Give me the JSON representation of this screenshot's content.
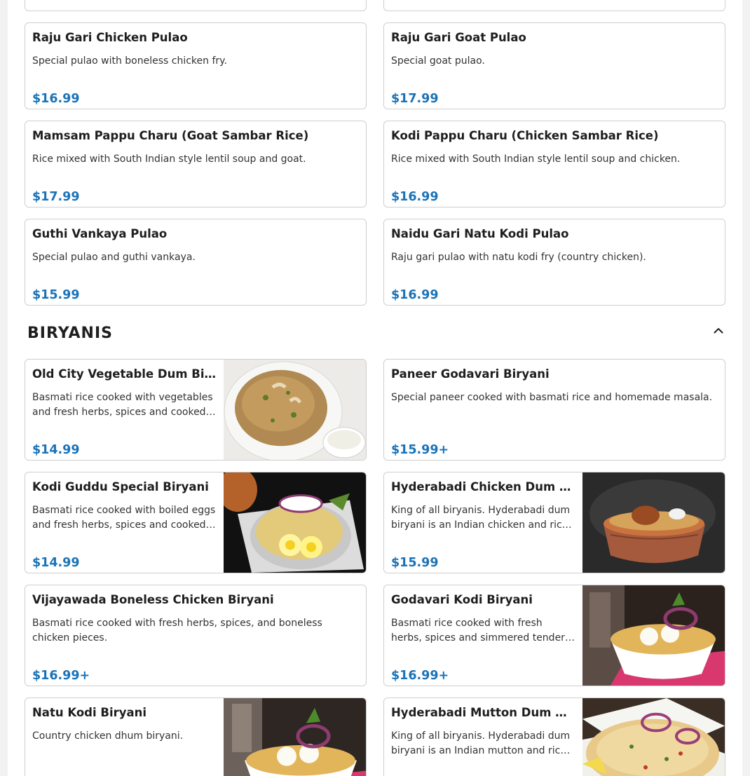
{
  "pulao_items": [
    {
      "name": "Raju Gari Chicken Pulao",
      "description": "Special pulao with boneless chicken fry.",
      "price": "$16.99"
    },
    {
      "name": "Raju Gari Goat Pulao",
      "description": "Special goat pulao.",
      "price": "$17.99"
    },
    {
      "name": "Mamsam Pappu Charu (Goat Sambar Rice)",
      "description": "Rice mixed with South Indian style lentil soup and goat.",
      "price": "$17.99"
    },
    {
      "name": "Kodi Pappu Charu (Chicken Sambar Rice)",
      "description": "Rice mixed with South Indian style lentil soup and chicken.",
      "price": "$16.99"
    },
    {
      "name": "Guthi Vankaya Pulao",
      "description": "Special pulao and guthi vankaya.",
      "price": "$15.99"
    },
    {
      "name": "Naidu Gari Natu Kodi Pulao",
      "description": "Raju gari pulao with natu kodi fry (country chicken).",
      "price": "$16.99"
    }
  ],
  "biryanis": {
    "title": "BIRYANIS",
    "collapse_icon": "chevron-up-icon",
    "items": [
      {
        "name": "Old City Vegetable Dum Biryani",
        "description": "Basmati rice cooked with vegetables and fresh herbs, spices and cooked in dum style.",
        "price": "$14.99"
      },
      {
        "name": "Paneer Godavari Biryani",
        "description": "Special paneer cooked with basmati rice and homemade masala.",
        "price": "$15.99+"
      },
      {
        "name": "Kodi Guddu Special Biryani",
        "description": "Basmati rice cooked with boiled eggs and fresh herbs, spices and cooked in dum style.",
        "price": "$14.99"
      },
      {
        "name": "Hyderabadi Chicken Dum Biryani",
        "description": "King of all biryanis. Hyderabadi dum biryani is an Indian chicken and rice dish.",
        "price": "$15.99"
      },
      {
        "name": "Vijayawada Boneless Chicken Biryani",
        "description": "Basmati rice cooked with fresh herbs, spices, and boneless chicken pieces.",
        "price": "$16.99+"
      },
      {
        "name": "Godavari Kodi Biryani",
        "description": "Basmati rice cooked with fresh herbs, spices and simmered tender chicken.",
        "price": "$16.99+"
      },
      {
        "name": "Natu Kodi Biryani",
        "description": "Country chicken dhum biryani.",
        "price": ""
      },
      {
        "name": "Hyderabadi Mutton Dum Biryani",
        "description": "King of all biryanis. Hyderabadi dum biryani is an Indian mutton and rice dish.",
        "price": ""
      }
    ]
  }
}
